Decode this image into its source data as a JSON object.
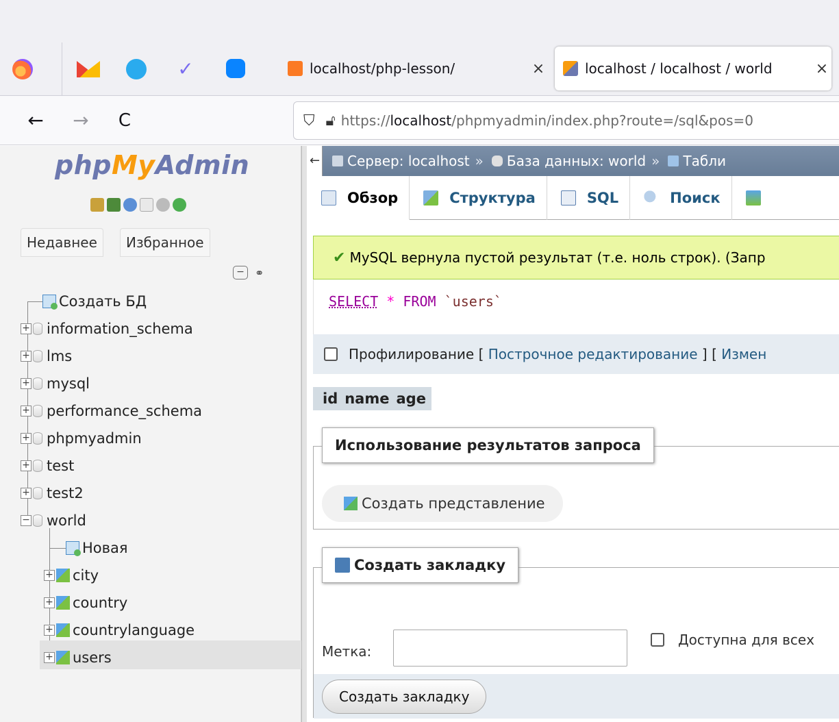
{
  "browser": {
    "tabs": [
      {
        "title": "localhost/php-lesson/",
        "close": "×"
      },
      {
        "title": "localhost / localhost / world",
        "close": "×"
      }
    ],
    "nav": {
      "back": "←",
      "forward": "→",
      "reload": "C"
    },
    "url": {
      "scheme": "https://",
      "host": "localhost",
      "path": "/phpmyadmin/index.php?route=/sql&pos=0"
    }
  },
  "sidebar": {
    "logo": {
      "php": "php",
      "my": "My",
      "admin": "Admin"
    },
    "tabs": [
      "Недавнее",
      "Избранное"
    ],
    "tree": {
      "create_db": "Создать БД",
      "databases": [
        "information_schema",
        "lms",
        "mysql",
        "performance_schema",
        "phpmyadmin",
        "test",
        "test2",
        "world"
      ],
      "world_children": {
        "new": "Новая",
        "tables": [
          "city",
          "country",
          "countrylanguage",
          "users"
        ]
      }
    }
  },
  "main": {
    "breadcrumb": {
      "server": "Сервер: localhost",
      "sep": "»",
      "database": "База данных: world",
      "table": "Табли"
    },
    "tabs": [
      "Обзор",
      "Структура",
      "SQL",
      "Поиск"
    ],
    "success_message": "MySQL вернула пустой результат (т.е. ноль строк). (Запр",
    "sql": {
      "select": "SELECT",
      "star": "*",
      "from": "FROM",
      "table": "`users`"
    },
    "profiling": {
      "label": "Профилирование",
      "bracket_open": "[",
      "inline_edit": "Построчное редактирование",
      "bracket_close": "] [",
      "edit": "Измен"
    },
    "columns": [
      "id",
      "name",
      "age"
    ],
    "query_results": {
      "legend": "Использование результатов запроса",
      "create_view": "Создать представление"
    },
    "bookmark": {
      "legend": "Создать закладку",
      "label": "Метка:",
      "shared": "Доступна для всех",
      "button": "Создать закладку"
    }
  },
  "colors": {
    "accent": "#235a81",
    "success_bg": "#ebf8a4",
    "logo_blue": "#6c78af",
    "logo_orange": "#f89c0e"
  }
}
